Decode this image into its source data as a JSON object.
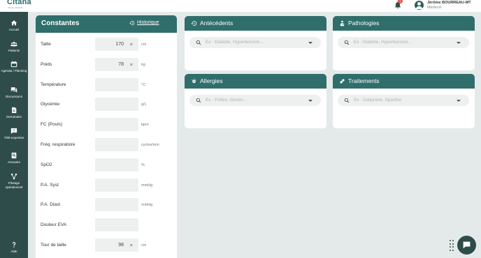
{
  "brand": {
    "name": "Citana",
    "tagline": "Groupe Doctolib"
  },
  "header": {
    "notifications_count": "1",
    "user_name": "Jérôme BOURREAU-MT",
    "user_role": "Médecin"
  },
  "sidebar": {
    "items": [
      {
        "label": "Accueil",
        "icon": "home-icon"
      },
      {
        "label": "Patients",
        "icon": "users-icon"
      },
      {
        "label": "Agenda / Planning",
        "icon": "calendar-icon"
      },
      {
        "label": "Discussions",
        "icon": "chat-icon"
      },
      {
        "label": "Demandes",
        "icon": "document-icon"
      },
      {
        "label": "Télé-expertise",
        "icon": "message-alert-icon"
      },
      {
        "label": "Annuaire",
        "icon": "directory-icon"
      },
      {
        "label": "Pilotage opérationnel",
        "icon": "network-icon"
      },
      {
        "label": "Aide",
        "icon": "help-icon"
      }
    ]
  },
  "constantes": {
    "title": "Constantes",
    "history_label": "Historique",
    "rows": [
      {
        "label": "Taille",
        "value": "170",
        "unit": "cm",
        "clear": "×"
      },
      {
        "label": "Poids",
        "value": "78",
        "unit": "kg",
        "clear": "×"
      },
      {
        "label": "Température",
        "value": "",
        "unit": "°C",
        "clear": ""
      },
      {
        "label": "Glycémie",
        "value": "",
        "unit": "g/L",
        "clear": ""
      },
      {
        "label": "FC (Pouls)",
        "value": "",
        "unit": "bpm",
        "clear": ""
      },
      {
        "label": "Fréq. respiratoire",
        "value": "",
        "unit": "cycles/min",
        "clear": ""
      },
      {
        "label": "SpO2",
        "value": "",
        "unit": "%",
        "clear": ""
      },
      {
        "label": "P.A. Syst",
        "value": "",
        "unit": "mmHg",
        "clear": ""
      },
      {
        "label": "P.A. Diast",
        "value": "",
        "unit": "mmHg",
        "clear": ""
      },
      {
        "label": "Douleur EVA",
        "value": "",
        "unit": "",
        "clear": ""
      },
      {
        "label": "Tour de taille",
        "value": "98",
        "unit": "cm",
        "clear": "×"
      }
    ]
  },
  "cards": {
    "antecedents": {
      "title": "Antécédents",
      "placeholder": "Ex : Diabète, Hypertension..."
    },
    "pathologies": {
      "title": "Pathologies",
      "placeholder": "Ex : Diabète, Hypertension..."
    },
    "allergies": {
      "title": "Allergies",
      "placeholder": "Ex : Pollen, Gluten..."
    },
    "traitements": {
      "title": "Traitements",
      "placeholder": "Ex : Doliprane, Spasfon"
    }
  },
  "colors": {
    "sidebar": "#2e4c4a",
    "header_teal": "#2f6e6b",
    "background": "#e4eaea",
    "badge": "#e4534f"
  }
}
